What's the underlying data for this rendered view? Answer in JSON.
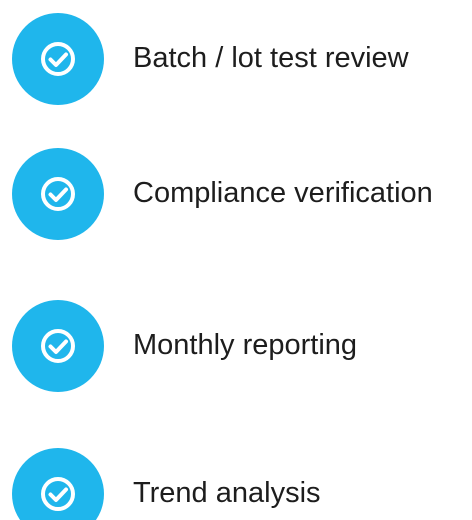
{
  "icon": {
    "name": "check-circle-icon",
    "color": "#1fb6ec",
    "mark_color": "#ffffff"
  },
  "items": [
    {
      "label": "Batch / lot test review"
    },
    {
      "label": "Compliance verification"
    },
    {
      "label": "Monthly reporting"
    },
    {
      "label": "Trend analysis"
    }
  ]
}
